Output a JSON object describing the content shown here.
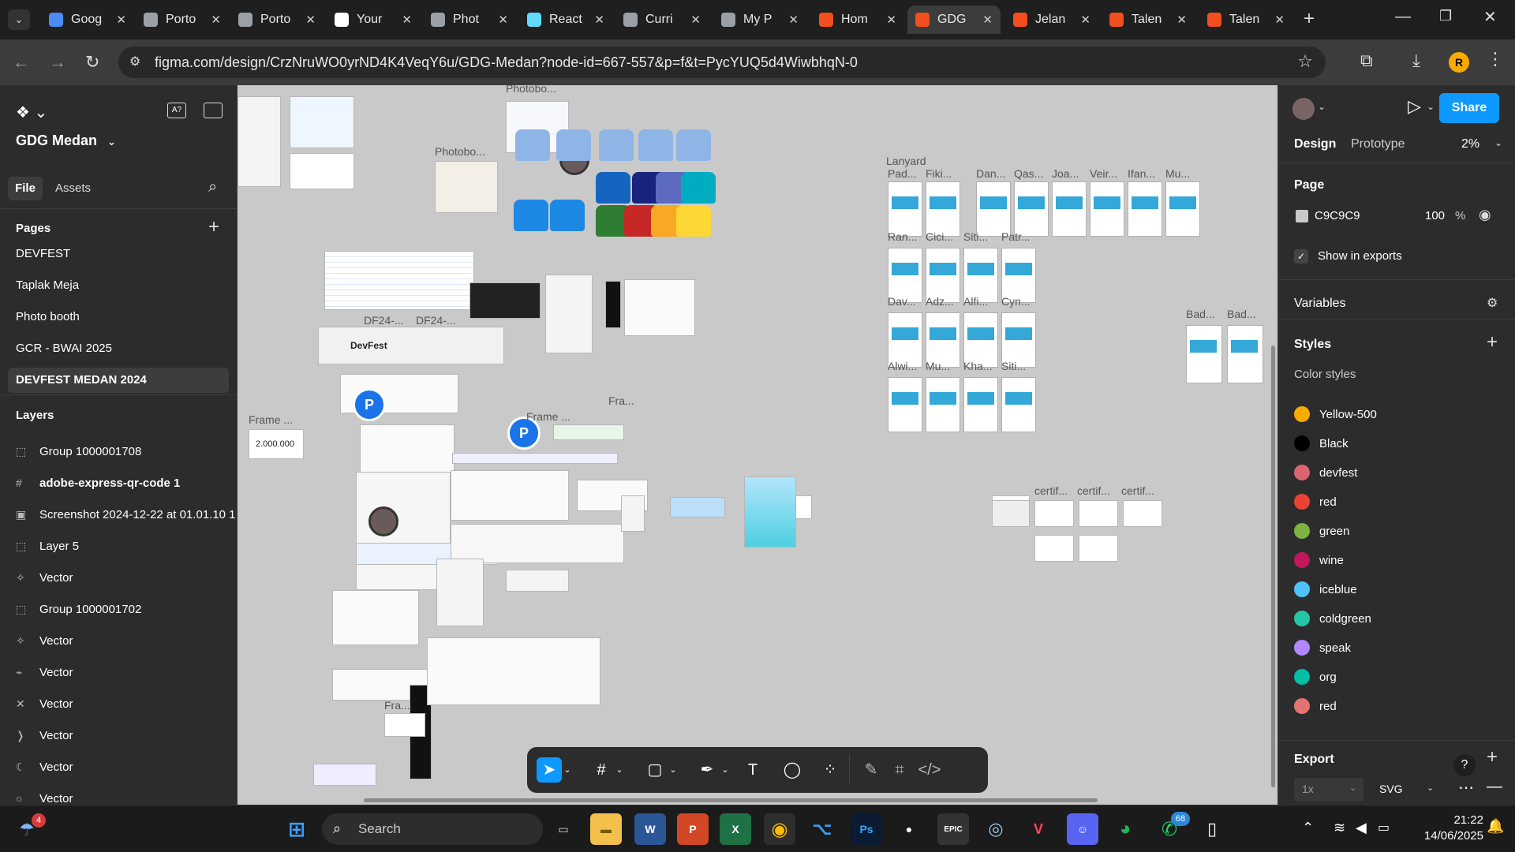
{
  "browser": {
    "tabs": [
      {
        "title": "Goog",
        "color": "#4c8bf5"
      },
      {
        "title": "Porto",
        "color": "#9aa0a6"
      },
      {
        "title": "Porto",
        "color": "#9aa0a6"
      },
      {
        "title": "Your",
        "color": "#ffffff"
      },
      {
        "title": "Phot",
        "color": "#9aa0a6"
      },
      {
        "title": "React",
        "color": "#61dafb"
      },
      {
        "title": "Curri",
        "color": "#9aa0a6"
      },
      {
        "title": "My P",
        "color": "#9aa0a6"
      },
      {
        "title": "Hom",
        "color": "#f24e1e"
      },
      {
        "title": "GDG",
        "color": "#f24e1e"
      },
      {
        "title": "Jelan",
        "color": "#f24e1e"
      },
      {
        "title": "Talen",
        "color": "#f24e1e"
      },
      {
        "title": "Talen",
        "color": "#f24e1e"
      }
    ],
    "url": "figma.com/design/CrzNruWO0yrND4K4VeqY6u/GDG-Medan?node-id=667-557&p=f&t=PycYUQ5d4WiwbhqN-0",
    "profile_initial": "R"
  },
  "left": {
    "file_name": "GDG Medan",
    "tab_file": "File",
    "tab_assets": "Assets",
    "pages_heading": "Pages",
    "pages": [
      "DEVFEST",
      "Taplak Meja",
      "Photo booth",
      "GCR - BWAI 2025",
      "DEVFEST MEDAN 2024"
    ],
    "layers_heading": "Layers",
    "layers": [
      {
        "icon": "⬚",
        "name": "Group 1000001708",
        "bold": false
      },
      {
        "icon": "#",
        "name": "adobe-express-qr-code 1",
        "bold": true
      },
      {
        "icon": "▣",
        "name": "Screenshot 2024-12-22 at 01.01.10 1",
        "bold": false
      },
      {
        "icon": "⬚",
        "name": "Layer 5",
        "bold": false
      },
      {
        "icon": "✧",
        "name": "Vector",
        "bold": false
      },
      {
        "icon": "⬚",
        "name": "Group 1000001702",
        "bold": false
      },
      {
        "icon": "✧",
        "name": "Vector",
        "bold": false
      },
      {
        "icon": "⌁",
        "name": "Vector",
        "bold": false
      },
      {
        "icon": "✕",
        "name": "Vector",
        "bold": false
      },
      {
        "icon": "❭",
        "name": "Vector",
        "bold": false
      },
      {
        "icon": "☾",
        "name": "Vector",
        "bold": false
      },
      {
        "icon": "○",
        "name": "Vector",
        "bold": false
      }
    ]
  },
  "canvas": {
    "labels": {
      "photobooth1": "Photobo...",
      "photobooth2": "Photobo...",
      "lanyard": "Lanyard",
      "frame_left": "Frame ...",
      "price": "2.000.000",
      "frame_mid": "Frame ...",
      "fra1": "Fra...",
      "df1": "DF24-...",
      "df2": "DF24-...",
      "badge1": "Bad...",
      "badge2": "Bad...",
      "certif1": "certif...",
      "certif2": "certif...",
      "certif3": "certif...",
      "framebottom": "Fra...",
      "devfest": "DevFest"
    },
    "lanyard_names_top": [
      "Pad...",
      "Fiki...",
      "Dan...",
      "Qas...",
      "Joa...",
      "Veir...",
      "Ifan...",
      "Mu..."
    ],
    "lanyard_rows": [
      "Ran...",
      "Cici...",
      "Siti...",
      "Patr...",
      "Dav...",
      "Adz...",
      "Alfi...",
      "Cyn...",
      "Alwi...",
      "Mu...",
      "Kha...",
      "Siti..."
    ],
    "avatar_p": "P"
  },
  "right": {
    "tab_design": "Design",
    "tab_prototype": "Prototype",
    "zoom": "2%",
    "share": "Share",
    "page_heading": "Page",
    "page_color": "C9C9C9",
    "page_opacity": "100",
    "percent": "%",
    "show_in_exports": "Show in exports",
    "variables": "Variables",
    "styles": "Styles",
    "color_styles": "Color styles",
    "colors": [
      {
        "name": "Yellow-500",
        "hex": "#f9ab00"
      },
      {
        "name": "Black",
        "hex": "#000000"
      },
      {
        "name": "devfest",
        "hex": "#d96570"
      },
      {
        "name": "red",
        "hex": "#ea4335"
      },
      {
        "name": "green",
        "hex": "#7cb342"
      },
      {
        "name": "wine",
        "hex": "#c2185b"
      },
      {
        "name": "iceblue",
        "hex": "#4fc3f7"
      },
      {
        "name": "coldgreen",
        "hex": "#26c6a6"
      },
      {
        "name": "speak",
        "hex": "#b388ff"
      },
      {
        "name": "org",
        "hex": "#00bfa5"
      },
      {
        "name": "red",
        "hex": "#e57373"
      }
    ],
    "export": "Export",
    "export_scale": "1x",
    "export_format": "SVG"
  },
  "taskbar": {
    "search": "Search",
    "time": "21:22",
    "date": "14/06/2025",
    "weather_badge": "4",
    "whatsapp_badge": "68"
  }
}
